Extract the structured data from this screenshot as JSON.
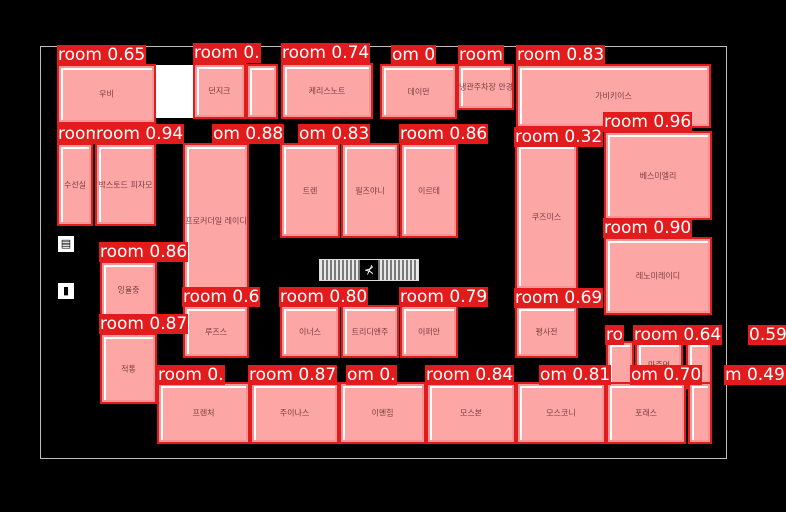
{
  "map": {
    "accent_color": "#e21c1c",
    "room_fill_color": "#fca6a6",
    "escalator_icon": "escalator-icon",
    "facility_icons": [
      "elevator-icon",
      "restroom-icon"
    ]
  },
  "rooms": [
    {
      "name": "우비",
      "tag": "room 0.65"
    },
    {
      "name": "던지크",
      "tag": "room 0."
    },
    {
      "name": "",
      "tag": ""
    },
    {
      "name": "케리스노트",
      "tag": "room 0.74"
    },
    {
      "name": "데이먼",
      "tag": "om 0"
    },
    {
      "name": "냉관주차장 안경류",
      "tag": "room"
    },
    {
      "name": "가비키이스",
      "tag": "room 0.83"
    },
    {
      "name": "수선실",
      "tag": "room"
    },
    {
      "name": "박스토드 피자모",
      "tag": "room 0.94"
    },
    {
      "name": "프로커더일 레이디",
      "tag": "om 0.88"
    },
    {
      "name": "트렌",
      "tag": "om 0.83"
    },
    {
      "name": "필즈야니",
      "tag": ""
    },
    {
      "name": "이르테",
      "tag": "room 0.86"
    },
    {
      "name": "쿠즈미스",
      "tag": "room 0.32"
    },
    {
      "name": "베스미엘리",
      "tag": "room 0.96"
    },
    {
      "name": "레노미레이디",
      "tag": "room 0.90"
    },
    {
      "name": "잉율충",
      "tag": "room 0.86"
    },
    {
      "name": "적통",
      "tag": "room 0.87"
    },
    {
      "name": "루즈스",
      "tag": "room 0.6"
    },
    {
      "name": "이너스",
      "tag": "room 0.80"
    },
    {
      "name": "트리디앤주",
      "tag": ""
    },
    {
      "name": "이퍼안",
      "tag": "room 0.79"
    },
    {
      "name": "평사전",
      "tag": "room 0.69"
    },
    {
      "name": "",
      "tag": "ro"
    },
    {
      "name": "마주먼",
      "tag": "room 0.64"
    },
    {
      "name": "",
      "tag": "0.59"
    },
    {
      "name": "프렌처",
      "tag": "room 0."
    },
    {
      "name": "주이나스",
      "tag": "room 0.87"
    },
    {
      "name": "이멘힘",
      "tag": "om 0."
    },
    {
      "name": "모스본",
      "tag": "room 0.84"
    },
    {
      "name": "모스코니",
      "tag": "om 0.81"
    },
    {
      "name": "포래스",
      "tag": "om 0.70"
    },
    {
      "name": "",
      "tag": "m 0.49"
    }
  ]
}
